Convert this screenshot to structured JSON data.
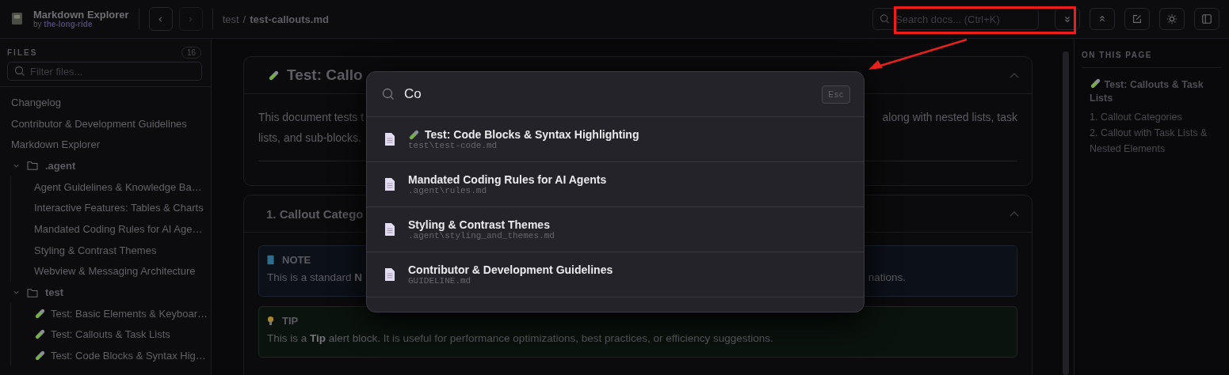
{
  "app": {
    "title": "Markdown Explorer",
    "byline": "by",
    "author": "the-long-ride"
  },
  "nav": {
    "back_disabled": false,
    "forward_disabled": true
  },
  "breadcrumb": {
    "folder": "test",
    "separator": "/",
    "file": "test-callouts.md"
  },
  "search": {
    "placeholder": "Search docs... (Ctrl+K)"
  },
  "toolbar": [
    {
      "kind": "expand"
    },
    {
      "kind": "collapse"
    },
    {
      "kind": "edit"
    },
    {
      "kind": "theme"
    },
    {
      "kind": "sidebar"
    }
  ],
  "sidebar": {
    "heading": "FILES",
    "count": "16",
    "filter_placeholder": "Filter files...",
    "tree": [
      {
        "label": "Changelog",
        "kind": "file"
      },
      {
        "label": "Contributor & Development Guidelines",
        "kind": "file"
      },
      {
        "label": "Markdown Explorer",
        "kind": "file"
      },
      {
        "label": ".agent",
        "kind": "folder",
        "expanded": true,
        "children": [
          {
            "label": "Agent Guidelines & Knowledge Ba…",
            "kind": "file"
          },
          {
            "label": "Interactive Features: Tables & Charts",
            "kind": "file"
          },
          {
            "label": "Mandated Coding Rules for AI Age…",
            "kind": "file"
          },
          {
            "label": "Styling & Contrast Themes",
            "kind": "file"
          },
          {
            "label": "Webview & Messaging Architecture",
            "kind": "file"
          }
        ]
      },
      {
        "label": "test",
        "kind": "folder",
        "expanded": true,
        "children": [
          {
            "label": "Test: Basic Elements & Keyboar…",
            "kind": "test"
          },
          {
            "label": "Test: Callouts & Task Lists",
            "kind": "test"
          },
          {
            "label": "Test: Code Blocks & Syntax Hig…",
            "kind": "test"
          }
        ]
      }
    ]
  },
  "cards": [
    {
      "kind": "title",
      "title": "Test: Callo",
      "expanded": true,
      "lines": [
        {
          "left": "This document tests t",
          "right": "along with nested lists, task"
        },
        {
          "left": "lists, and sub-blocks."
        }
      ]
    },
    {
      "kind": "section",
      "title": "1. Callout Catego",
      "expanded": true,
      "callouts": [
        {
          "kind": "note",
          "label": "NOTE",
          "left": "This is a standard **N**",
          "right": "nations."
        },
        {
          "kind": "tip",
          "label": "TIP",
          "left": "This is a **Tip** alert block. It is useful for performance optimizations, best practices, or efficiency suggestions."
        }
      ]
    }
  ],
  "toc": {
    "heading": "ON THIS PAGE",
    "items": [
      {
        "kind": "title",
        "label": "Test: Callouts & Task Lists"
      },
      {
        "kind": "section",
        "label": "1. Callout Categories"
      },
      {
        "kind": "section",
        "label": "2. Callout with Task Lists & Nested Elements"
      }
    ]
  },
  "palette": {
    "query": "Co",
    "shortcut": "Esc",
    "results": [
      {
        "kind": "test",
        "title": "Test: Code Blocks & Syntax Highlighting",
        "path": "test\\test-code.md"
      },
      {
        "kind": "doc",
        "title": "Mandated Coding Rules for AI Agents",
        "path": ".agent\\rules.md"
      },
      {
        "kind": "doc",
        "title": "Styling & Contrast Themes",
        "path": ".agent\\styling_and_themes.md"
      },
      {
        "kind": "doc",
        "title": "Contributor & Development Guidelines",
        "path": "GUIDELINE.md"
      }
    ]
  }
}
